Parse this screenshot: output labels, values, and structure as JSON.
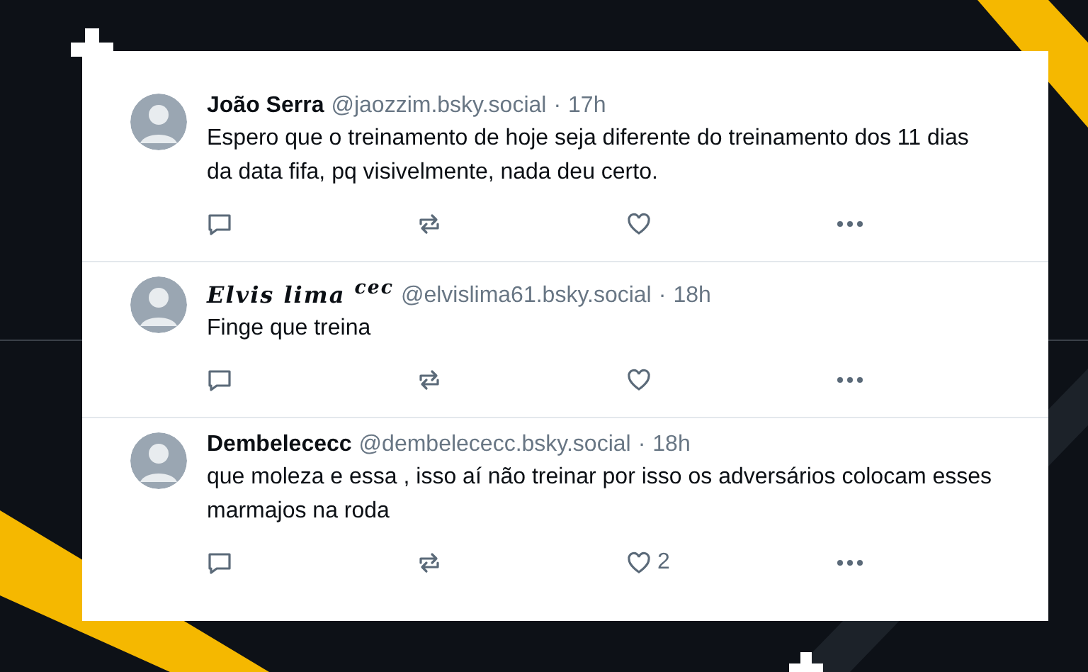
{
  "posts": [
    {
      "author": "João Serra",
      "handle": "@jaozzim.bsky.social",
      "separator": "·",
      "time": "17h",
      "text": "Espero que o treinamento de hoje seja diferente do treinamento dos 11 dias da data fifa, pq visivelmente, nada deu certo.",
      "fancy_name": false
    },
    {
      "author": "Elvis lima $^{cec}$",
      "handle": "@elvislima61.bsky.social",
      "separator": "·",
      "time": "18h",
      "text": "Finge que treina",
      "fancy_name": true
    },
    {
      "author": "Dembelececc",
      "handle": "@dembelececc.bsky.social",
      "separator": "·",
      "time": "18h",
      "text": "que moleza e essa , isso aí não treinar por isso os adversários colocam esses marmajos na roda",
      "likes": "2",
      "fancy_name": false
    }
  ]
}
